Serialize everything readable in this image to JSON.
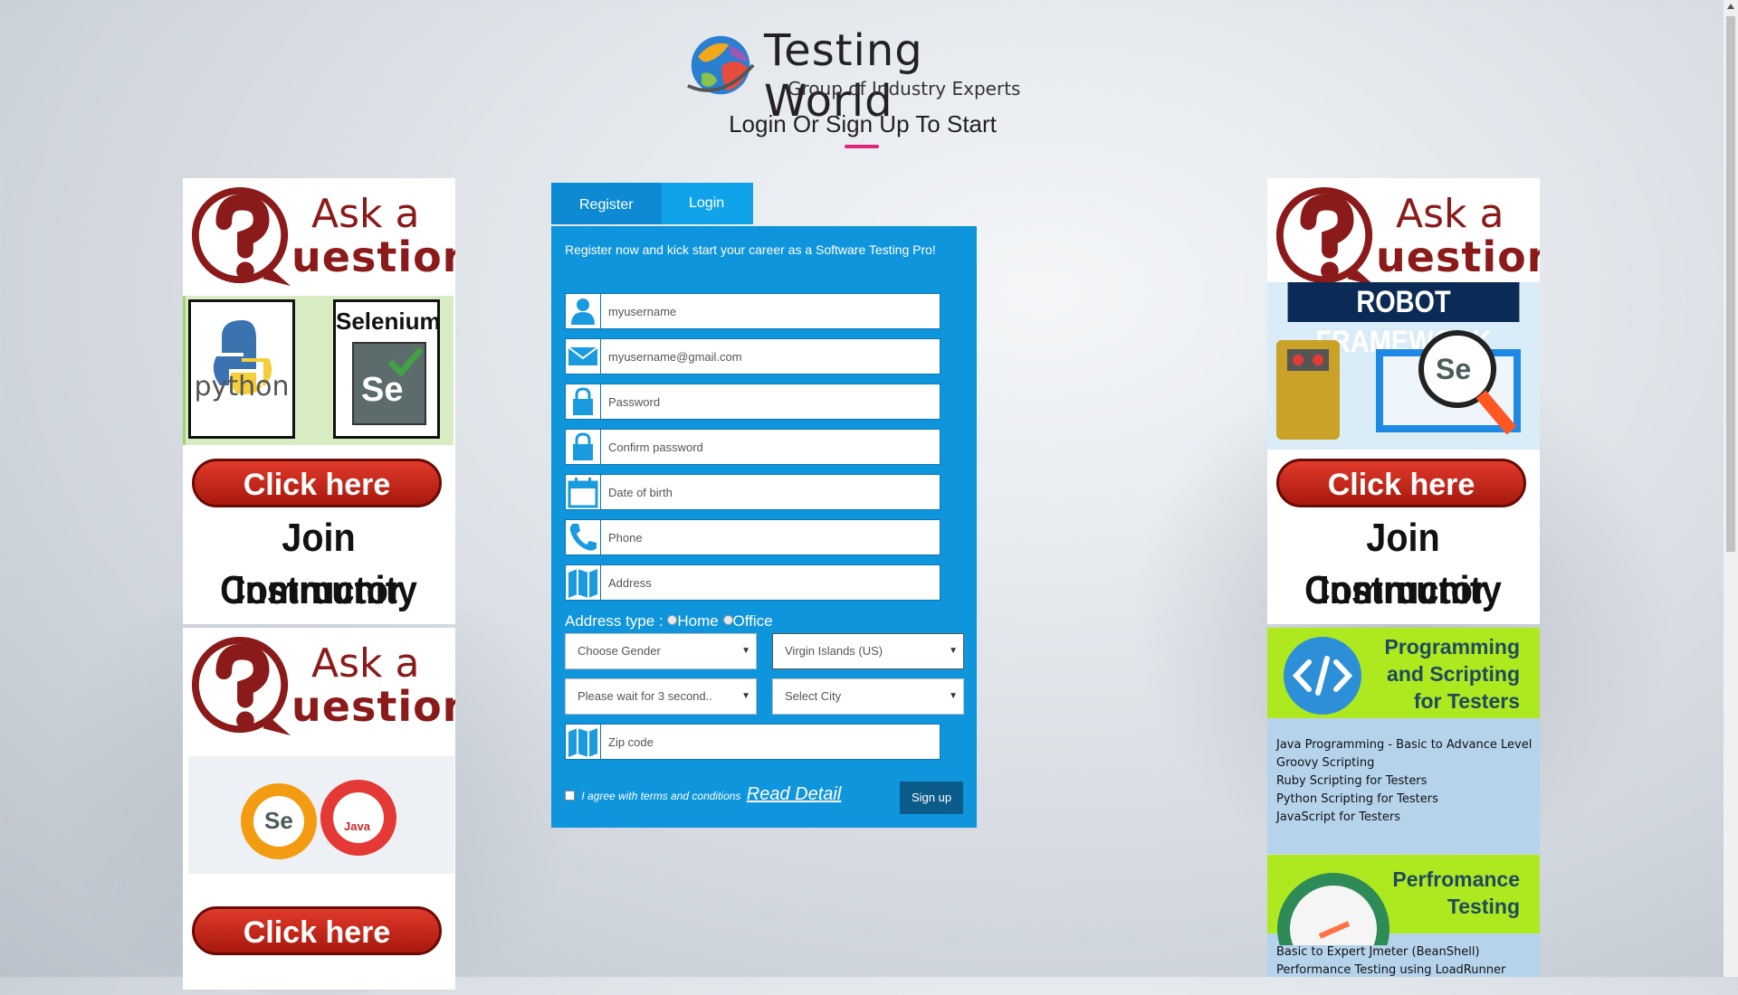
{
  "header": {
    "logo_title": "Testing World",
    "logo_subtitle": "Group of Industry Experts",
    "heading": "Login Or Sign Up To Start"
  },
  "ads": {
    "ask_a": "Ask a",
    "uestion": "uestion",
    "click_here": "Click here",
    "join_line1": "Join Instructor",
    "join_line2": "Community",
    "python_label": "python",
    "selenium_label": "Selenium",
    "se_label": "Se",
    "java_label": "Java",
    "robot_framework": "ROBOT FRAMEWORK"
  },
  "tabs": {
    "register": "Register",
    "login": "Login"
  },
  "form": {
    "intro": "Register now and kick start your career as a Software Testing Pro!",
    "username_placeholder": "myusername",
    "email_placeholder": "myusername@gmail.com",
    "password_placeholder": "Password",
    "confirm_placeholder": "Confirm password",
    "dob_placeholder": "Date of birth",
    "phone_placeholder": "Phone",
    "address_placeholder": "Address",
    "address_type_label": "Address type :",
    "home": "Home",
    "office": "Office",
    "gender": "Choose Gender",
    "country": "Virgin Islands (US)",
    "state": "Please wait for 3 second..",
    "city": "Select City",
    "zip_placeholder": "Zip code",
    "terms": "I agree with terms and conditions",
    "read_detail": "Read Detail",
    "signup": "Sign up"
  },
  "promo1": {
    "title_l1": "Programming",
    "title_l2": "and Scripting",
    "title_l3": "for Testers",
    "items": [
      "Java Programming - Basic to Advance Level",
      "Groovy Scripting",
      "Ruby Scripting for Testers",
      "Python Scripting for Testers",
      "JavaScript for Testers"
    ]
  },
  "promo2": {
    "title_l1": "Perfromance",
    "title_l2": "Testing",
    "items": [
      "Basic to Expert Jmeter (BeanShell)",
      "Performance Testing using LoadRunner"
    ]
  },
  "colors": {
    "form_bg": "#0f95dc",
    "tab_register": "#0d8ad3",
    "tab_login": "#11a3ea",
    "accent_pink": "#e0267d",
    "signup_btn": "#0b5c8a",
    "promo_green": "#aee81f",
    "promo_blue": "#b6d3ec"
  }
}
